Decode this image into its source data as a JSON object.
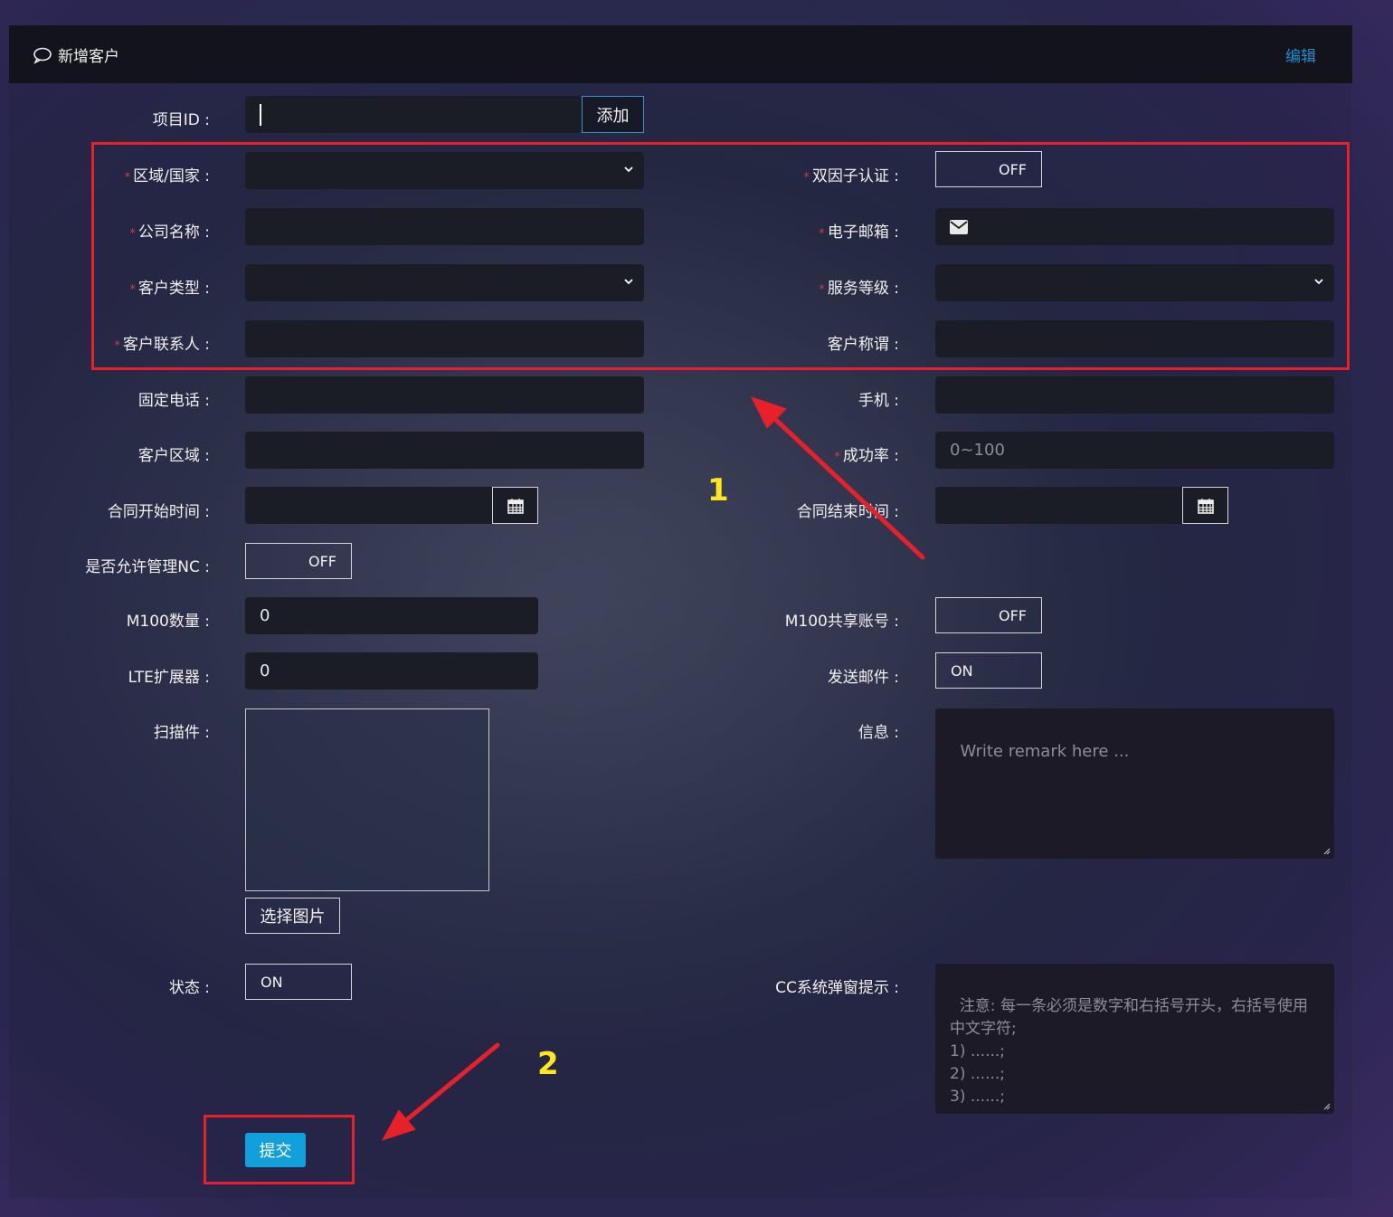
{
  "header": {
    "title": "新增客户",
    "edit_label": "编辑"
  },
  "project": {
    "label": "项目ID :",
    "add_label": "添加"
  },
  "left": {
    "region_label": "区域/国家 :",
    "company_label": "公司名称 :",
    "ctype_label": "客户类型 :",
    "contact_label": "客户联系人 :",
    "phone_label": "固定电话 :",
    "area_label": "客户区域 :",
    "contract_start_label": "合同开始时间 :",
    "nc_label": "是否允许管理NC :",
    "nc_value": "OFF",
    "m100_label": "M100数量 :",
    "m100_value": "0",
    "lte_label": "LTE扩展器 :",
    "lte_value": "0",
    "scan_label": "扫描件 :",
    "choose_image_label": "选择图片",
    "status_label": "状态 :",
    "status_value": "ON",
    "submit_label": "提交"
  },
  "right": {
    "twofa_label": "双因子认证 :",
    "twofa_value": "OFF",
    "email_label": "电子邮箱 :",
    "service_label": "服务等级 :",
    "title_label": "客户称谓 :",
    "mobile_label": "手机 :",
    "success_label": "成功率 :",
    "success_placeholder": "0~100",
    "contract_end_label": "合同结束时间 :",
    "m100share_label": "M100共享账号 :",
    "m100share_value": "OFF",
    "sendmail_label": "发送邮件 :",
    "sendmail_value": "ON",
    "info_label": "信息 :",
    "info_placeholder": "Write remark here ...",
    "cc_label": "CC系统弹窗提示 :",
    "cc_placeholder": "注意: 每一条必须是数字和右括号开头，右括号使用\n中文字符;\n1) ......;\n2) ......;\n3) ......;"
  },
  "annotations": {
    "num1": "1",
    "num2": "2"
  },
  "colors": {
    "accent": "#12a0dc",
    "required": "#d9363e",
    "annotation_red": "#e8202a",
    "annotation_yellow": "#ffe81a"
  }
}
